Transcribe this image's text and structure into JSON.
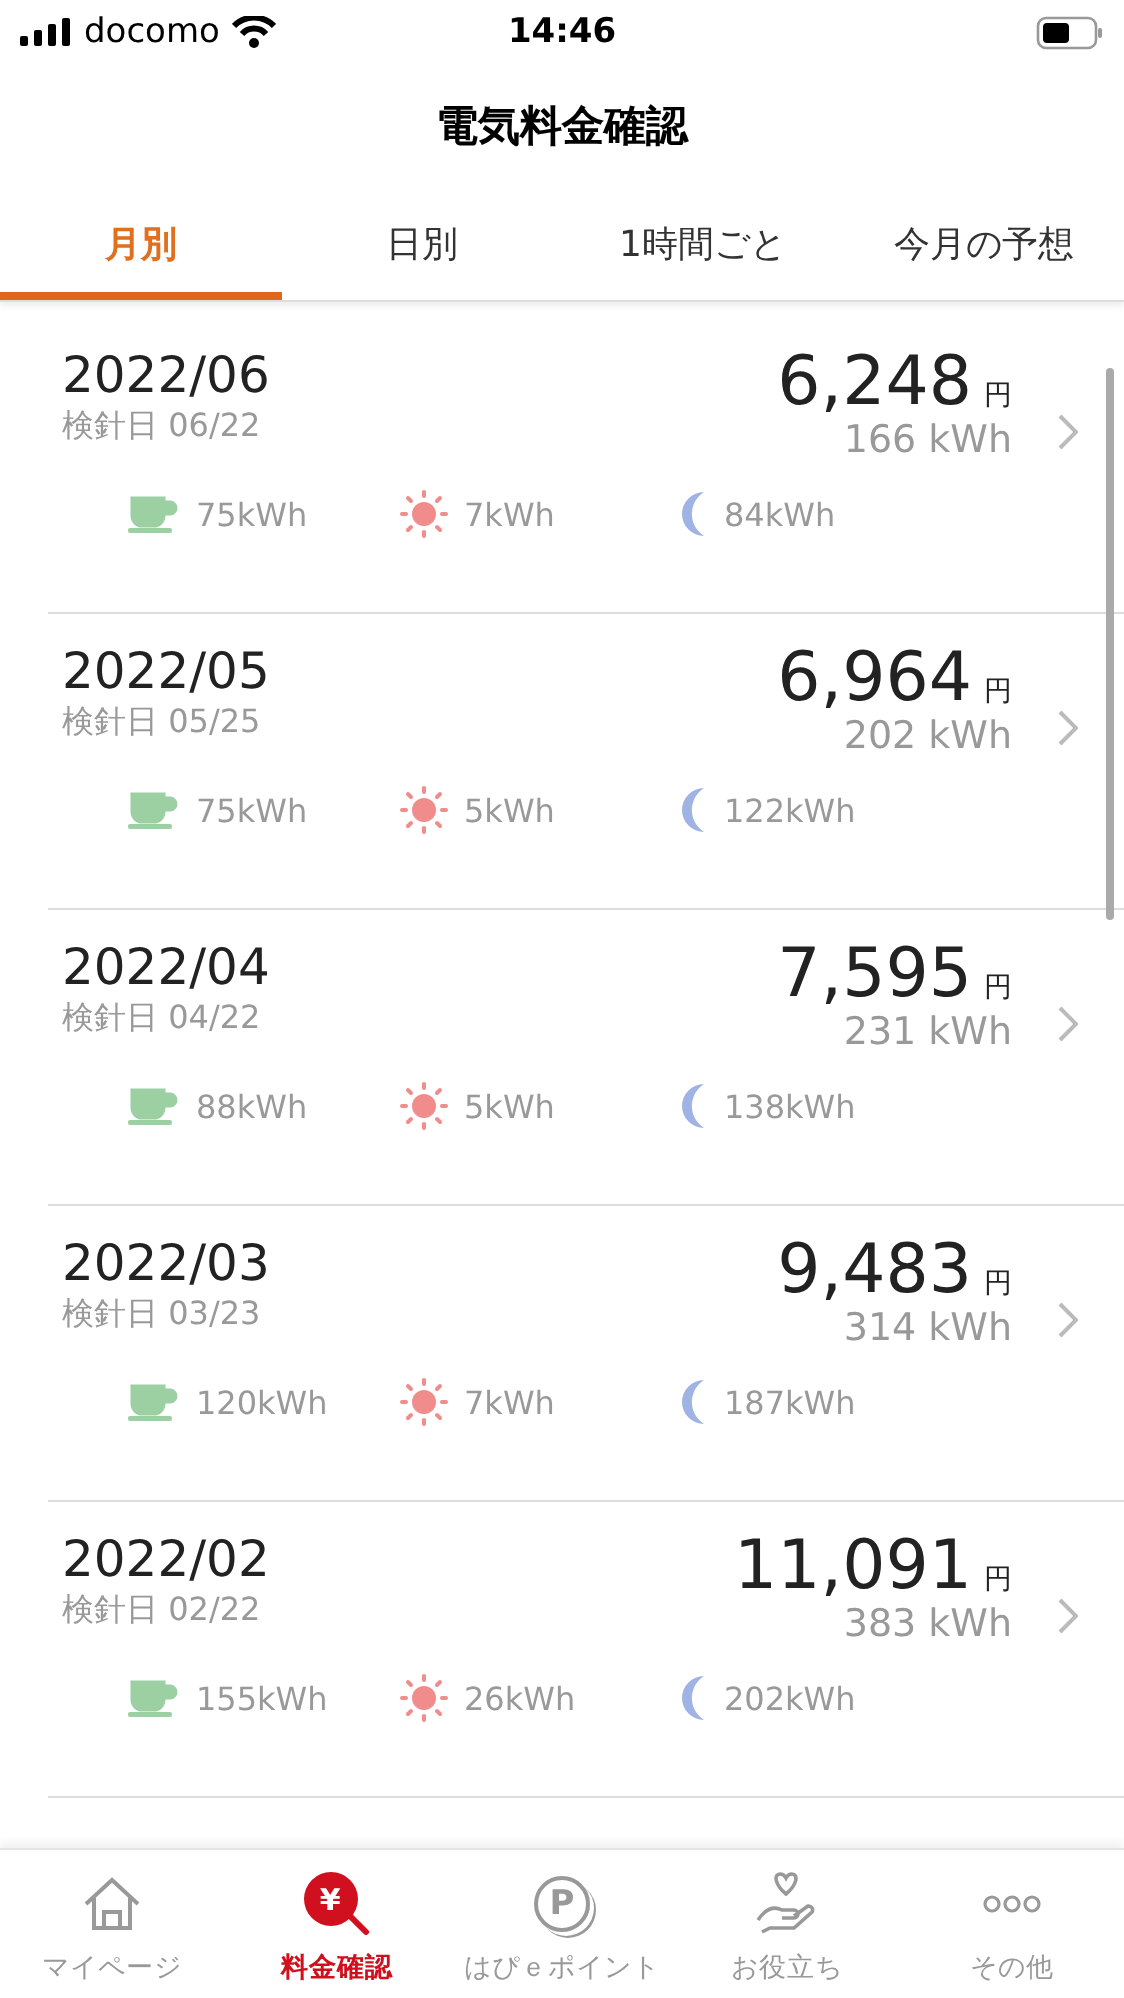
{
  "status_bar": {
    "carrier": "docomo",
    "time": "14:46"
  },
  "header": {
    "title": "電気料金確認"
  },
  "tabs": [
    {
      "label": "月別",
      "selected": true
    },
    {
      "label": "日別",
      "selected": false
    },
    {
      "label": "1時間ごと",
      "selected": false
    },
    {
      "label": "今月の予想",
      "selected": false
    }
  ],
  "bills": [
    {
      "month": "2022/06",
      "reading_date": "検針日 06/22",
      "amount": "6,248",
      "currency": "円",
      "usage": "166 kWh",
      "breakdown": [
        "75kWh",
        "7kWh",
        "84kWh"
      ]
    },
    {
      "month": "2022/05",
      "reading_date": "検針日 05/25",
      "amount": "6,964",
      "currency": "円",
      "usage": "202 kWh",
      "breakdown": [
        "75kWh",
        "5kWh",
        "122kWh"
      ]
    },
    {
      "month": "2022/04",
      "reading_date": "検針日 04/22",
      "amount": "7,595",
      "currency": "円",
      "usage": "231 kWh",
      "breakdown": [
        "88kWh",
        "5kWh",
        "138kWh"
      ]
    },
    {
      "month": "2022/03",
      "reading_date": "検針日 03/23",
      "amount": "9,483",
      "currency": "円",
      "usage": "314 kWh",
      "breakdown": [
        "120kWh",
        "7kWh",
        "187kWh"
      ]
    },
    {
      "month": "2022/02",
      "reading_date": "検針日 02/22",
      "amount": "11,091",
      "currency": "円",
      "usage": "383 kWh",
      "breakdown": [
        "155kWh",
        "26kWh",
        "202kWh"
      ]
    }
  ],
  "bottom_nav": [
    {
      "label": "マイページ",
      "selected": false
    },
    {
      "label": "料金確認",
      "selected": true,
      "icon_text": "¥"
    },
    {
      "label": "はぴｅポイント",
      "selected": false,
      "icon_text": "P"
    },
    {
      "label": "お役立ち",
      "selected": false
    },
    {
      "label": "その他",
      "selected": false
    }
  ]
}
